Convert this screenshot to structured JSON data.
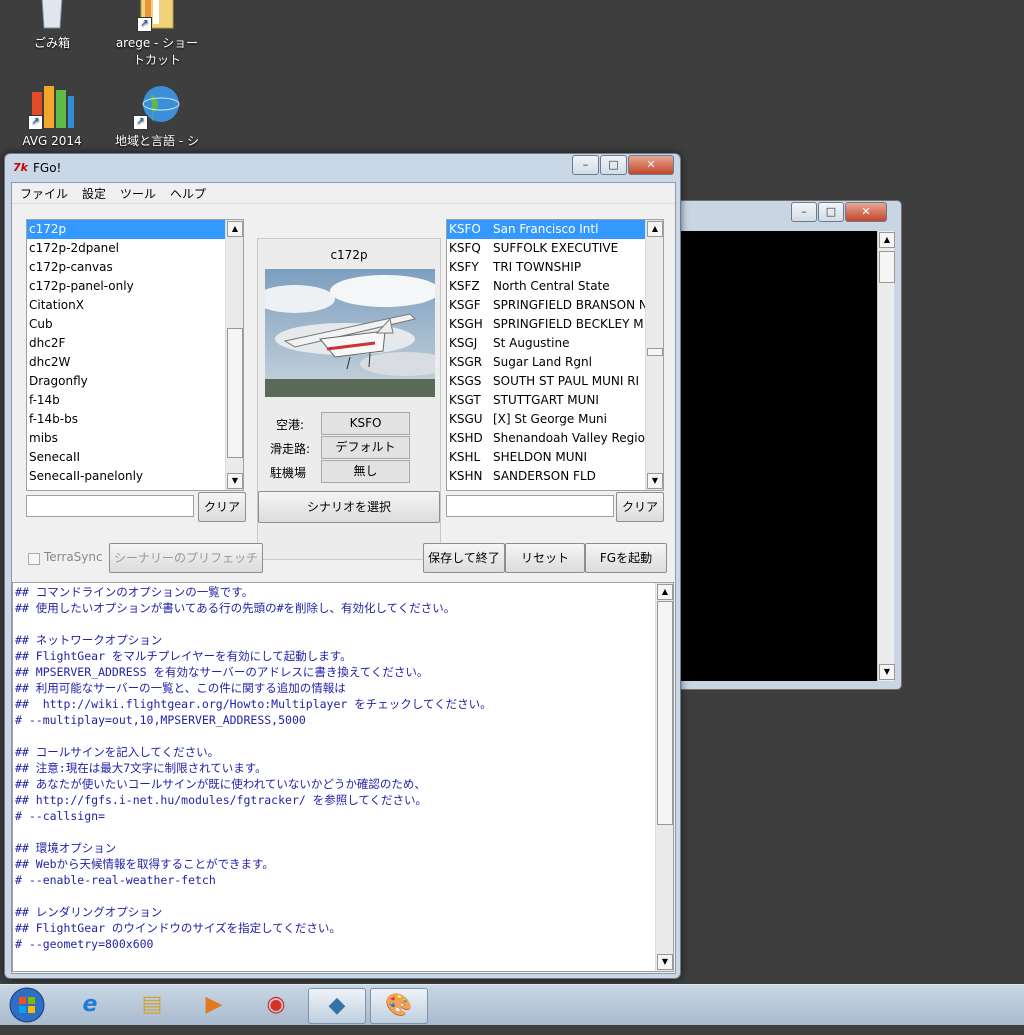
{
  "desktop": {
    "icons": [
      {
        "label": "ごみ箱",
        "name": "recycle-bin-icon"
      },
      {
        "label": "arege - ショートカット",
        "name": "folder-shortcut-icon"
      },
      {
        "label": "AVG 2014",
        "name": "avg-icon"
      },
      {
        "label": "地域と言語 - ショ",
        "name": "globe-icon"
      }
    ]
  },
  "window": {
    "title": "FGo!",
    "controls": {
      "minimize": "–",
      "maximize": "□",
      "close": "✕"
    }
  },
  "menubar": [
    "ファイル",
    "設定",
    "ツール",
    "ヘルプ"
  ],
  "aircraft": {
    "items": [
      "c172p",
      "c172p-2dpanel",
      "c172p-canvas",
      "c172p-panel-only",
      "CitationX",
      "Cub",
      "dhc2F",
      "dhc2W",
      "Dragonfly",
      "f-14b",
      "f-14b-bs",
      "mibs",
      "SenecaII",
      "SenecaII-panelonly"
    ],
    "selected_index": 0,
    "search_value": "",
    "clear_label": "クリア"
  },
  "preview": {
    "aircraft_name": "c172p",
    "airport_label": "空港:",
    "airport_value": "KSFO",
    "runway_label": "滑走路:",
    "runway_value": "デフォルト",
    "parking_label": "駐機場",
    "parking_value": "無し",
    "scenario_button": "シナリオを選択"
  },
  "airports": {
    "items": [
      {
        "code": "KSFO",
        "name": "San Francisco Intl"
      },
      {
        "code": "KSFQ",
        "name": "SUFFOLK EXECUTIVE"
      },
      {
        "code": "KSFY",
        "name": "TRI TOWNSHIP"
      },
      {
        "code": "KSFZ",
        "name": "North Central State"
      },
      {
        "code": "KSGF",
        "name": "SPRINGFIELD BRANSON N"
      },
      {
        "code": "KSGH",
        "name": "SPRINGFIELD BECKLEY M"
      },
      {
        "code": "KSGJ",
        "name": "St Augustine"
      },
      {
        "code": "KSGR",
        "name": "Sugar Land Rgnl"
      },
      {
        "code": "KSGS",
        "name": "SOUTH ST PAUL MUNI RI"
      },
      {
        "code": "KSGT",
        "name": "STUTTGART MUNI"
      },
      {
        "code": "KSGU",
        "name": "[X] St George Muni"
      },
      {
        "code": "KSHD",
        "name": "Shenandoah Valley Region"
      },
      {
        "code": "KSHL",
        "name": "SHELDON MUNI"
      },
      {
        "code": "KSHN",
        "name": "SANDERSON FLD"
      }
    ],
    "selected_index": 0,
    "search_value": "",
    "clear_label": "クリア"
  },
  "options": {
    "terrasync_label": "TerraSync",
    "terrasync_checked": false,
    "prefetch_label": "シーナリーのプリフェッチ",
    "save_quit": "保存して終了",
    "reset": "リセット",
    "launch": "FGを起動"
  },
  "config_lines": [
    "## コマンドラインのオプションの一覧です。",
    "## 使用したいオプションが書いてある行の先頭の#を削除し、有効化してください。",
    "",
    "## ネットワークオプション",
    "## FlightGear をマルチプレイヤーを有効にして起動します。",
    "## MPSERVER_ADDRESS を有効なサーバーのアドレスに書き換えてください。",
    "## 利用可能なサーバーの一覧と、この件に関する追加の情報は",
    "##  http://wiki.flightgear.org/Howto:Multiplayer をチェックしてください。",
    "# --multiplay=out,10,MPSERVER_ADDRESS,5000",
    "",
    "## コールサインを記入してください。",
    "## 注意:現在は最大7文字に制限されています。",
    "## あなたが使いたいコールサインが既に使われていないかどうか確認のため、",
    "## http://fgfs.i-net.hu/modules/fgtracker/ を参照してください。",
    "# --callsign=",
    "",
    "## 環境オプション",
    "## Webから天候情報を取得することができます。",
    "# --enable-real-weather-fetch",
    "",
    "## レンダリングオプション",
    "## FlightGear のウインドウのサイズを指定してください。",
    "# --geometry=800x600"
  ],
  "taskbar": {
    "items": [
      {
        "name": "start-orb-icon",
        "glyph": "⊞"
      },
      {
        "name": "internet-explorer-icon",
        "glyph": "e"
      },
      {
        "name": "file-explorer-icon",
        "glyph": "▤"
      },
      {
        "name": "media-player-icon",
        "glyph": "▶"
      },
      {
        "name": "chrome-icon",
        "glyph": "◉"
      },
      {
        "name": "python-icon",
        "glyph": "◆"
      },
      {
        "name": "paint-icon",
        "glyph": "🎨"
      }
    ]
  }
}
